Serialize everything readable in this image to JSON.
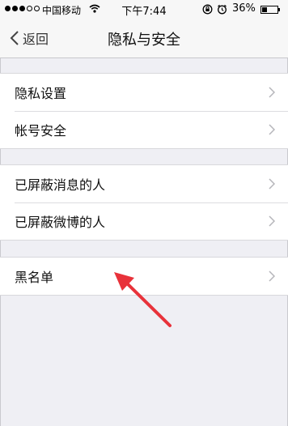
{
  "status_bar": {
    "carrier": "中国移动",
    "time": "下午7:44",
    "battery_percent": "36%",
    "battery_level": 0.36
  },
  "nav": {
    "back_label": "返回",
    "title": "隐私与安全"
  },
  "groups": [
    {
      "items": [
        {
          "label": "隐私设置"
        },
        {
          "label": "帐号安全"
        }
      ]
    },
    {
      "items": [
        {
          "label": "已屏蔽消息的人"
        },
        {
          "label": "已屏蔽微博的人"
        }
      ]
    },
    {
      "items": [
        {
          "label": "黑名单"
        }
      ]
    }
  ],
  "colors": {
    "background": "#efeff4",
    "annotation": "#e8323a"
  }
}
